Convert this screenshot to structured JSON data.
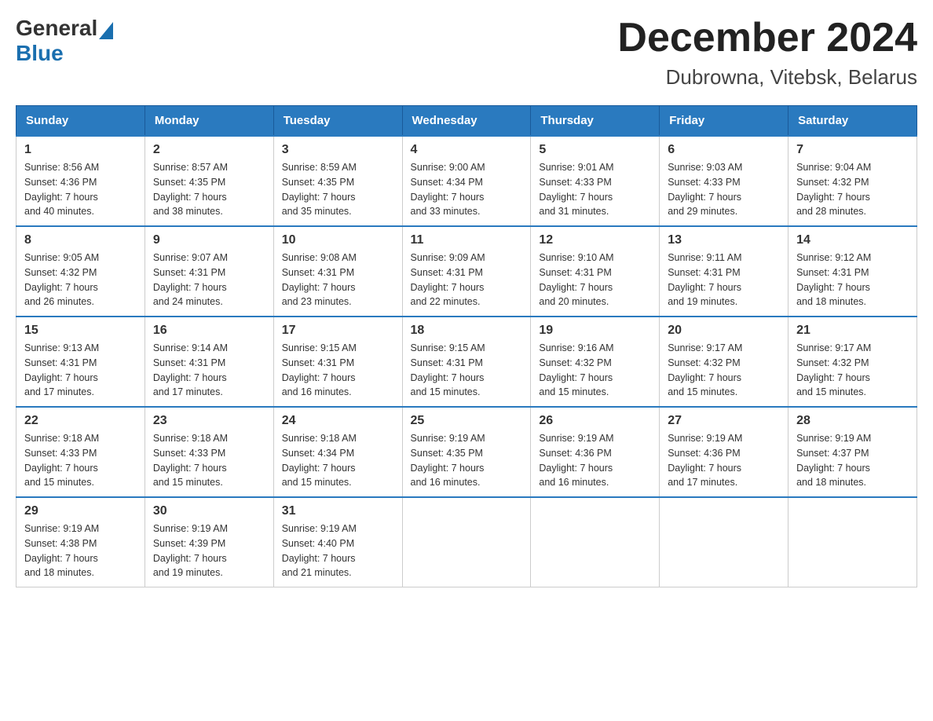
{
  "header": {
    "logo_general": "General",
    "logo_blue": "Blue",
    "month_title": "December 2024",
    "location": "Dubrowna, Vitebsk, Belarus"
  },
  "days_of_week": [
    "Sunday",
    "Monday",
    "Tuesday",
    "Wednesday",
    "Thursday",
    "Friday",
    "Saturday"
  ],
  "weeks": [
    [
      {
        "date": "1",
        "sunrise": "8:56 AM",
        "sunset": "4:36 PM",
        "daylight": "7 hours and 40 minutes."
      },
      {
        "date": "2",
        "sunrise": "8:57 AM",
        "sunset": "4:35 PM",
        "daylight": "7 hours and 38 minutes."
      },
      {
        "date": "3",
        "sunrise": "8:59 AM",
        "sunset": "4:35 PM",
        "daylight": "7 hours and 35 minutes."
      },
      {
        "date": "4",
        "sunrise": "9:00 AM",
        "sunset": "4:34 PM",
        "daylight": "7 hours and 33 minutes."
      },
      {
        "date": "5",
        "sunrise": "9:01 AM",
        "sunset": "4:33 PM",
        "daylight": "7 hours and 31 minutes."
      },
      {
        "date": "6",
        "sunrise": "9:03 AM",
        "sunset": "4:33 PM",
        "daylight": "7 hours and 29 minutes."
      },
      {
        "date": "7",
        "sunrise": "9:04 AM",
        "sunset": "4:32 PM",
        "daylight": "7 hours and 28 minutes."
      }
    ],
    [
      {
        "date": "8",
        "sunrise": "9:05 AM",
        "sunset": "4:32 PM",
        "daylight": "7 hours and 26 minutes."
      },
      {
        "date": "9",
        "sunrise": "9:07 AM",
        "sunset": "4:31 PM",
        "daylight": "7 hours and 24 minutes."
      },
      {
        "date": "10",
        "sunrise": "9:08 AM",
        "sunset": "4:31 PM",
        "daylight": "7 hours and 23 minutes."
      },
      {
        "date": "11",
        "sunrise": "9:09 AM",
        "sunset": "4:31 PM",
        "daylight": "7 hours and 22 minutes."
      },
      {
        "date": "12",
        "sunrise": "9:10 AM",
        "sunset": "4:31 PM",
        "daylight": "7 hours and 20 minutes."
      },
      {
        "date": "13",
        "sunrise": "9:11 AM",
        "sunset": "4:31 PM",
        "daylight": "7 hours and 19 minutes."
      },
      {
        "date": "14",
        "sunrise": "9:12 AM",
        "sunset": "4:31 PM",
        "daylight": "7 hours and 18 minutes."
      }
    ],
    [
      {
        "date": "15",
        "sunrise": "9:13 AM",
        "sunset": "4:31 PM",
        "daylight": "7 hours and 17 minutes."
      },
      {
        "date": "16",
        "sunrise": "9:14 AM",
        "sunset": "4:31 PM",
        "daylight": "7 hours and 17 minutes."
      },
      {
        "date": "17",
        "sunrise": "9:15 AM",
        "sunset": "4:31 PM",
        "daylight": "7 hours and 16 minutes."
      },
      {
        "date": "18",
        "sunrise": "9:15 AM",
        "sunset": "4:31 PM",
        "daylight": "7 hours and 15 minutes."
      },
      {
        "date": "19",
        "sunrise": "9:16 AM",
        "sunset": "4:32 PM",
        "daylight": "7 hours and 15 minutes."
      },
      {
        "date": "20",
        "sunrise": "9:17 AM",
        "sunset": "4:32 PM",
        "daylight": "7 hours and 15 minutes."
      },
      {
        "date": "21",
        "sunrise": "9:17 AM",
        "sunset": "4:32 PM",
        "daylight": "7 hours and 15 minutes."
      }
    ],
    [
      {
        "date": "22",
        "sunrise": "9:18 AM",
        "sunset": "4:33 PM",
        "daylight": "7 hours and 15 minutes."
      },
      {
        "date": "23",
        "sunrise": "9:18 AM",
        "sunset": "4:33 PM",
        "daylight": "7 hours and 15 minutes."
      },
      {
        "date": "24",
        "sunrise": "9:18 AM",
        "sunset": "4:34 PM",
        "daylight": "7 hours and 15 minutes."
      },
      {
        "date": "25",
        "sunrise": "9:19 AM",
        "sunset": "4:35 PM",
        "daylight": "7 hours and 16 minutes."
      },
      {
        "date": "26",
        "sunrise": "9:19 AM",
        "sunset": "4:36 PM",
        "daylight": "7 hours and 16 minutes."
      },
      {
        "date": "27",
        "sunrise": "9:19 AM",
        "sunset": "4:36 PM",
        "daylight": "7 hours and 17 minutes."
      },
      {
        "date": "28",
        "sunrise": "9:19 AM",
        "sunset": "4:37 PM",
        "daylight": "7 hours and 18 minutes."
      }
    ],
    [
      {
        "date": "29",
        "sunrise": "9:19 AM",
        "sunset": "4:38 PM",
        "daylight": "7 hours and 18 minutes."
      },
      {
        "date": "30",
        "sunrise": "9:19 AM",
        "sunset": "4:39 PM",
        "daylight": "7 hours and 19 minutes."
      },
      {
        "date": "31",
        "sunrise": "9:19 AM",
        "sunset": "4:40 PM",
        "daylight": "7 hours and 21 minutes."
      },
      null,
      null,
      null,
      null
    ]
  ],
  "labels": {
    "sunrise": "Sunrise:",
    "sunset": "Sunset:",
    "daylight": "Daylight:"
  }
}
